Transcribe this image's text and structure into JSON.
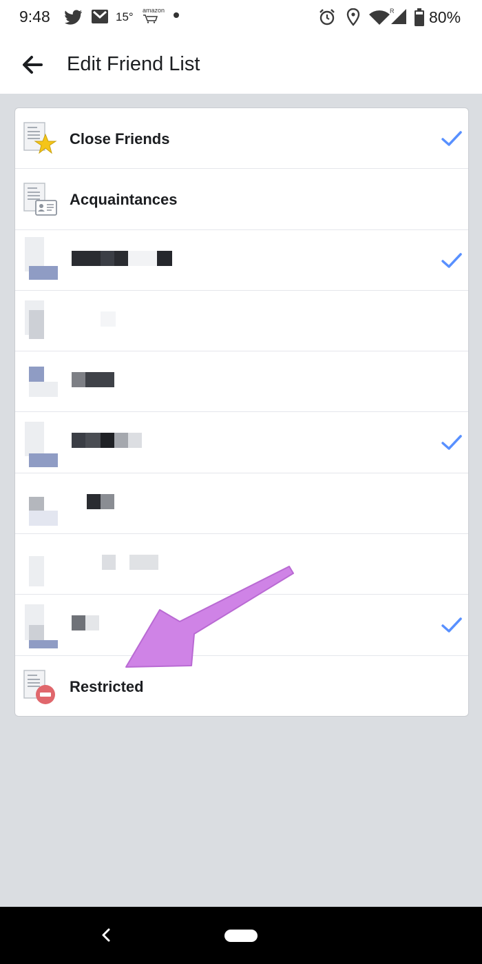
{
  "status_bar": {
    "time": "9:48",
    "temperature": "15°",
    "amazon_label": "amazon",
    "battery": "80%",
    "icons": [
      "twitter-icon",
      "gmail-icon",
      "amazon-icon",
      "alarm-icon",
      "location-icon",
      "wifi-icon",
      "signal-icon",
      "battery-icon"
    ]
  },
  "app_bar": {
    "title": "Edit Friend List",
    "back_icon": "arrow-left-icon"
  },
  "lists": [
    {
      "label": "Close Friends",
      "icon": "close-friends-star-icon",
      "checked": true
    },
    {
      "label": "Acquaintances",
      "icon": "acquaintances-card-icon",
      "checked": false
    },
    {
      "label": "",
      "icon": "list-icon",
      "checked": true,
      "redacted": true
    },
    {
      "label": "",
      "icon": "list-icon",
      "checked": false,
      "redacted": true
    },
    {
      "label": "",
      "icon": "list-icon",
      "checked": false,
      "redacted": true
    },
    {
      "label": "",
      "icon": "list-icon",
      "checked": true,
      "redacted": true
    },
    {
      "label": "",
      "icon": "list-icon",
      "checked": false,
      "redacted": true
    },
    {
      "label": "",
      "icon": "list-icon",
      "checked": false,
      "redacted": true
    },
    {
      "label": "",
      "icon": "list-icon",
      "checked": true,
      "redacted": true
    },
    {
      "label": "Restricted",
      "icon": "restricted-icon",
      "checked": false
    }
  ],
  "colors": {
    "check": "#5890ff",
    "annotation_arrow": "#cf83e6",
    "restricted_badge": "#e0676c",
    "star": "#f5c518",
    "background": "#dadde1"
  },
  "nav_bar": {
    "icons": [
      "nav-back-icon",
      "nav-home-pill"
    ]
  }
}
